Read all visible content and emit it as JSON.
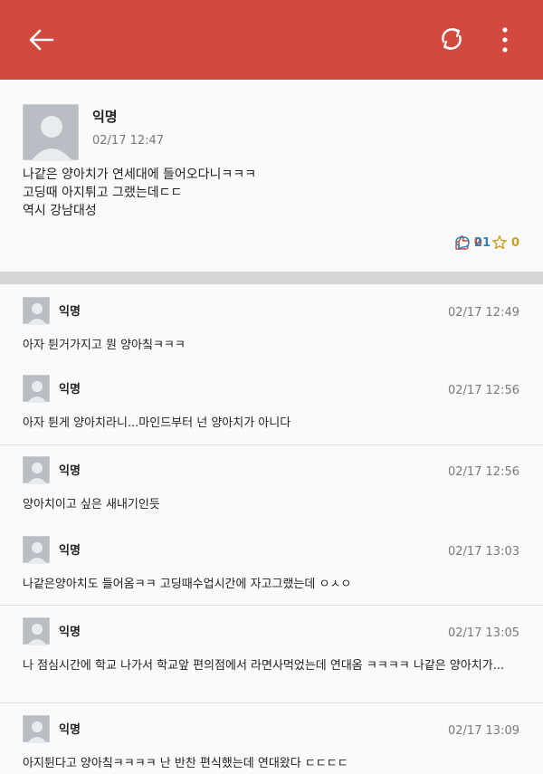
{
  "toolbar": {
    "back_icon": "arrow-left-icon",
    "refresh_icon": "refresh-icon",
    "more_icon": "more-vertical-icon",
    "accent": "#d24a3f"
  },
  "post": {
    "author": "익명",
    "time": "02/17 12:47",
    "lines": [
      "나같은 양아치가 연세대에 들어오다니ㅋㅋㅋ",
      "고딩때 아지튀고 그랬는데ㄷㄷ",
      "역시 강남대성"
    ],
    "likes": "0",
    "comments": "21",
    "scraps": "0"
  },
  "comments": [
    {
      "author": "익명",
      "time": "02/17 12:49",
      "text": "아자 튄거가지고 뭔 양아칰ㅋㅋㅋ"
    },
    {
      "author": "익명",
      "time": "02/17 12:56",
      "text": "아자 튄게 양아치라니...마인드부터 넌 양아치가 아니다"
    },
    {
      "author": "익명",
      "time": "02/17 12:56",
      "text": "양아치이고 싶은 새내기인듯"
    },
    {
      "author": "익명",
      "time": "02/17 13:03",
      "text": "나같은양아치도 들어옴ㅋㅋ 고딩때수업시간에 자고그랬는데 ㅇㅅㅇ"
    },
    {
      "author": "익명",
      "time": "02/17 13:05",
      "text": "나 점심시간에 학교 나가서 학교앞 편의점에서 라면사먹었는데 연대옴 ㅋㅋㅋㅋ 나같은 양아치가..."
    },
    {
      "author": "익명",
      "time": "02/17 13:09",
      "text": "아지튄다고 양아칰ㅋㅋㅋㅋ 난 반찬 편식했는데 연대왔다 ㄷㄷㄷㄷ"
    }
  ]
}
